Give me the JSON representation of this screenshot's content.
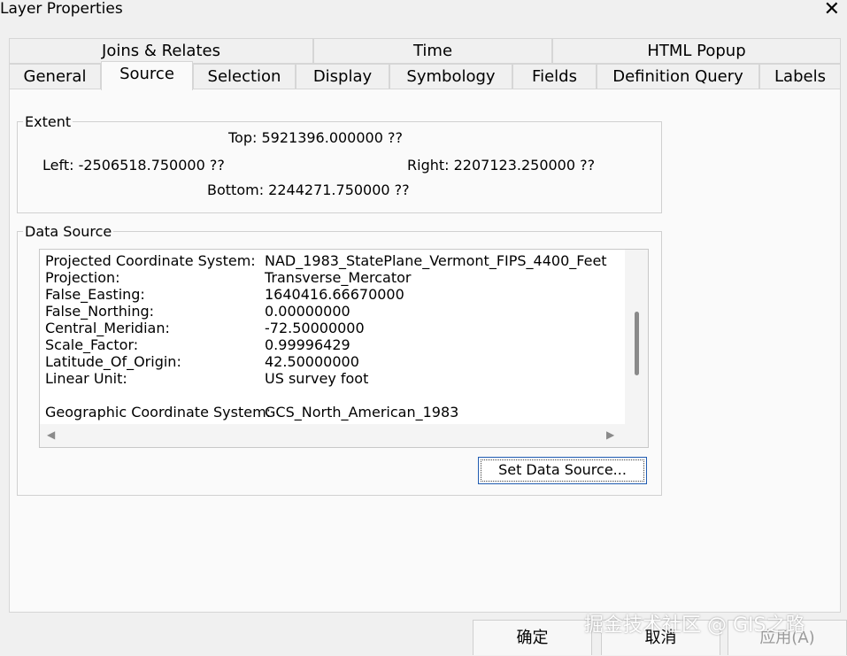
{
  "window": {
    "title": "Layer Properties"
  },
  "tabs_row1": [
    "Joins & Relates",
    "Time",
    "HTML Popup"
  ],
  "tabs_row2": [
    "General",
    "Source",
    "Selection",
    "Display",
    "Symbology",
    "Fields",
    "Definition Query",
    "Labels"
  ],
  "active_tab": "Source",
  "extent": {
    "legend": "Extent",
    "top": "Top:  5921396.000000 ??",
    "left": "Left: -2506518.750000 ??",
    "right": "Right:  2207123.250000 ??",
    "bottom": "Bottom:  2244271.750000 ??"
  },
  "data_source": {
    "legend": "Data Source",
    "rows": [
      {
        "key": "Projected Coordinate System:",
        "value": "NAD_1983_StatePlane_Vermont_FIPS_4400_Feet"
      },
      {
        "key": "Projection:",
        "value": "Transverse_Mercator"
      },
      {
        "key": "False_Easting:",
        "value": "1640416.66670000"
      },
      {
        "key": "False_Northing:",
        "value": "0.00000000"
      },
      {
        "key": "Central_Meridian:",
        "value": "-72.50000000"
      },
      {
        "key": "Scale_Factor:",
        "value": "0.99996429"
      },
      {
        "key": "Latitude_Of_Origin:",
        "value": "42.50000000"
      },
      {
        "key": "Linear Unit:",
        "value": "US survey foot"
      },
      {
        "key": "",
        "value": ""
      },
      {
        "key": "Geographic Coordinate System:",
        "value": "GCS_North_American_1983"
      }
    ],
    "set_button": "Set Data Source..."
  },
  "buttons": {
    "ok": "确定",
    "cancel": "取消",
    "apply": "应用(A)"
  },
  "watermark": "掘金技术社区 @ GIS之路"
}
